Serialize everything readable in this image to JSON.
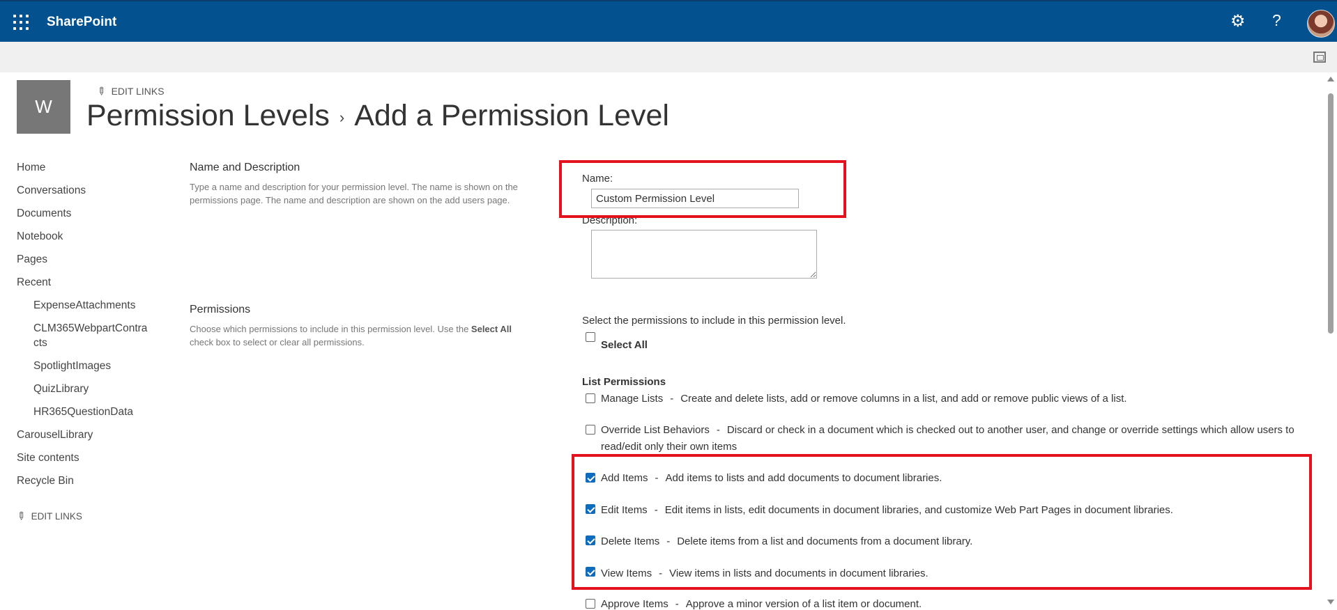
{
  "suitebar": {
    "brand": "SharePoint",
    "settings_icon": "gear-icon",
    "help_icon": "question-mark-icon",
    "app_launcher_icon": "waffle-icon"
  },
  "header": {
    "site_logo_letter": "W",
    "edit_links": "EDIT LINKS",
    "breadcrumb_parent": "Permission Levels",
    "breadcrumb_separator": "›",
    "breadcrumb_current": "Add a Permission Level"
  },
  "leftnav": {
    "items": [
      {
        "label": "Home"
      },
      {
        "label": "Conversations"
      },
      {
        "label": "Documents"
      },
      {
        "label": "Notebook"
      },
      {
        "label": "Pages"
      },
      {
        "label": "Recent"
      },
      {
        "label": "ExpenseAttachments"
      },
      {
        "label": "CLM365WebpartContra"
      },
      {
        "label": "cts"
      },
      {
        "label": "SpotlightImages"
      },
      {
        "label": "QuizLibrary"
      },
      {
        "label": "HR365QuestionData"
      },
      {
        "label": "CarouselLibrary"
      },
      {
        "label": "Site contents"
      },
      {
        "label": "Recycle Bin"
      }
    ],
    "edit_links": "EDIT LINKS"
  },
  "name_section": {
    "title": "Name and Description",
    "desc_line1": "Type a name and description for your permission level.  The name is shown on the",
    "desc_line2": "permissions page.  The name and description are shown on the add users page.",
    "name_label": "Name:",
    "name_value": "Custom Permission Level",
    "description_label": "Description:",
    "description_value": ""
  },
  "permissions_section": {
    "title": "Permissions",
    "desc_line1_pre": "Choose which permissions to include in this permission level.  Use the ",
    "desc_line1_bold": "Select All",
    "desc_line2": "check box to select or clear all permissions.",
    "instruction": "Select the permissions to include in this permission level.",
    "select_all": "Select All",
    "list_permissions_heading": "List Permissions",
    "items": [
      {
        "name": "Manage Lists",
        "desc": "Create and delete lists, add or remove columns in a list, and add or remove public views of a list.",
        "checked": false
      },
      {
        "name": "Override List Behaviors",
        "desc": "Discard or check in a document which is checked out to another user, and change or override settings which allow users to read/edit only their own items",
        "checked": false
      },
      {
        "name": "Add Items",
        "desc": "Add items to lists and add documents to document libraries.",
        "checked": true
      },
      {
        "name": "Edit Items",
        "desc": "Edit items in lists, edit documents in document libraries, and customize Web Part Pages in document libraries.",
        "checked": true
      },
      {
        "name": "Delete Items",
        "desc": "Delete items from a list and documents from a document library.",
        "checked": true
      },
      {
        "name": "View Items",
        "desc": "View items in lists and documents in document libraries.",
        "checked": true
      },
      {
        "name": "Approve Items",
        "desc": "Approve a minor version of a list item or document.",
        "checked": false
      }
    ]
  },
  "colors": {
    "suitebar": "#03518f",
    "highlight": "#e3121d",
    "checkbox_checked": "#0f6cbd"
  }
}
